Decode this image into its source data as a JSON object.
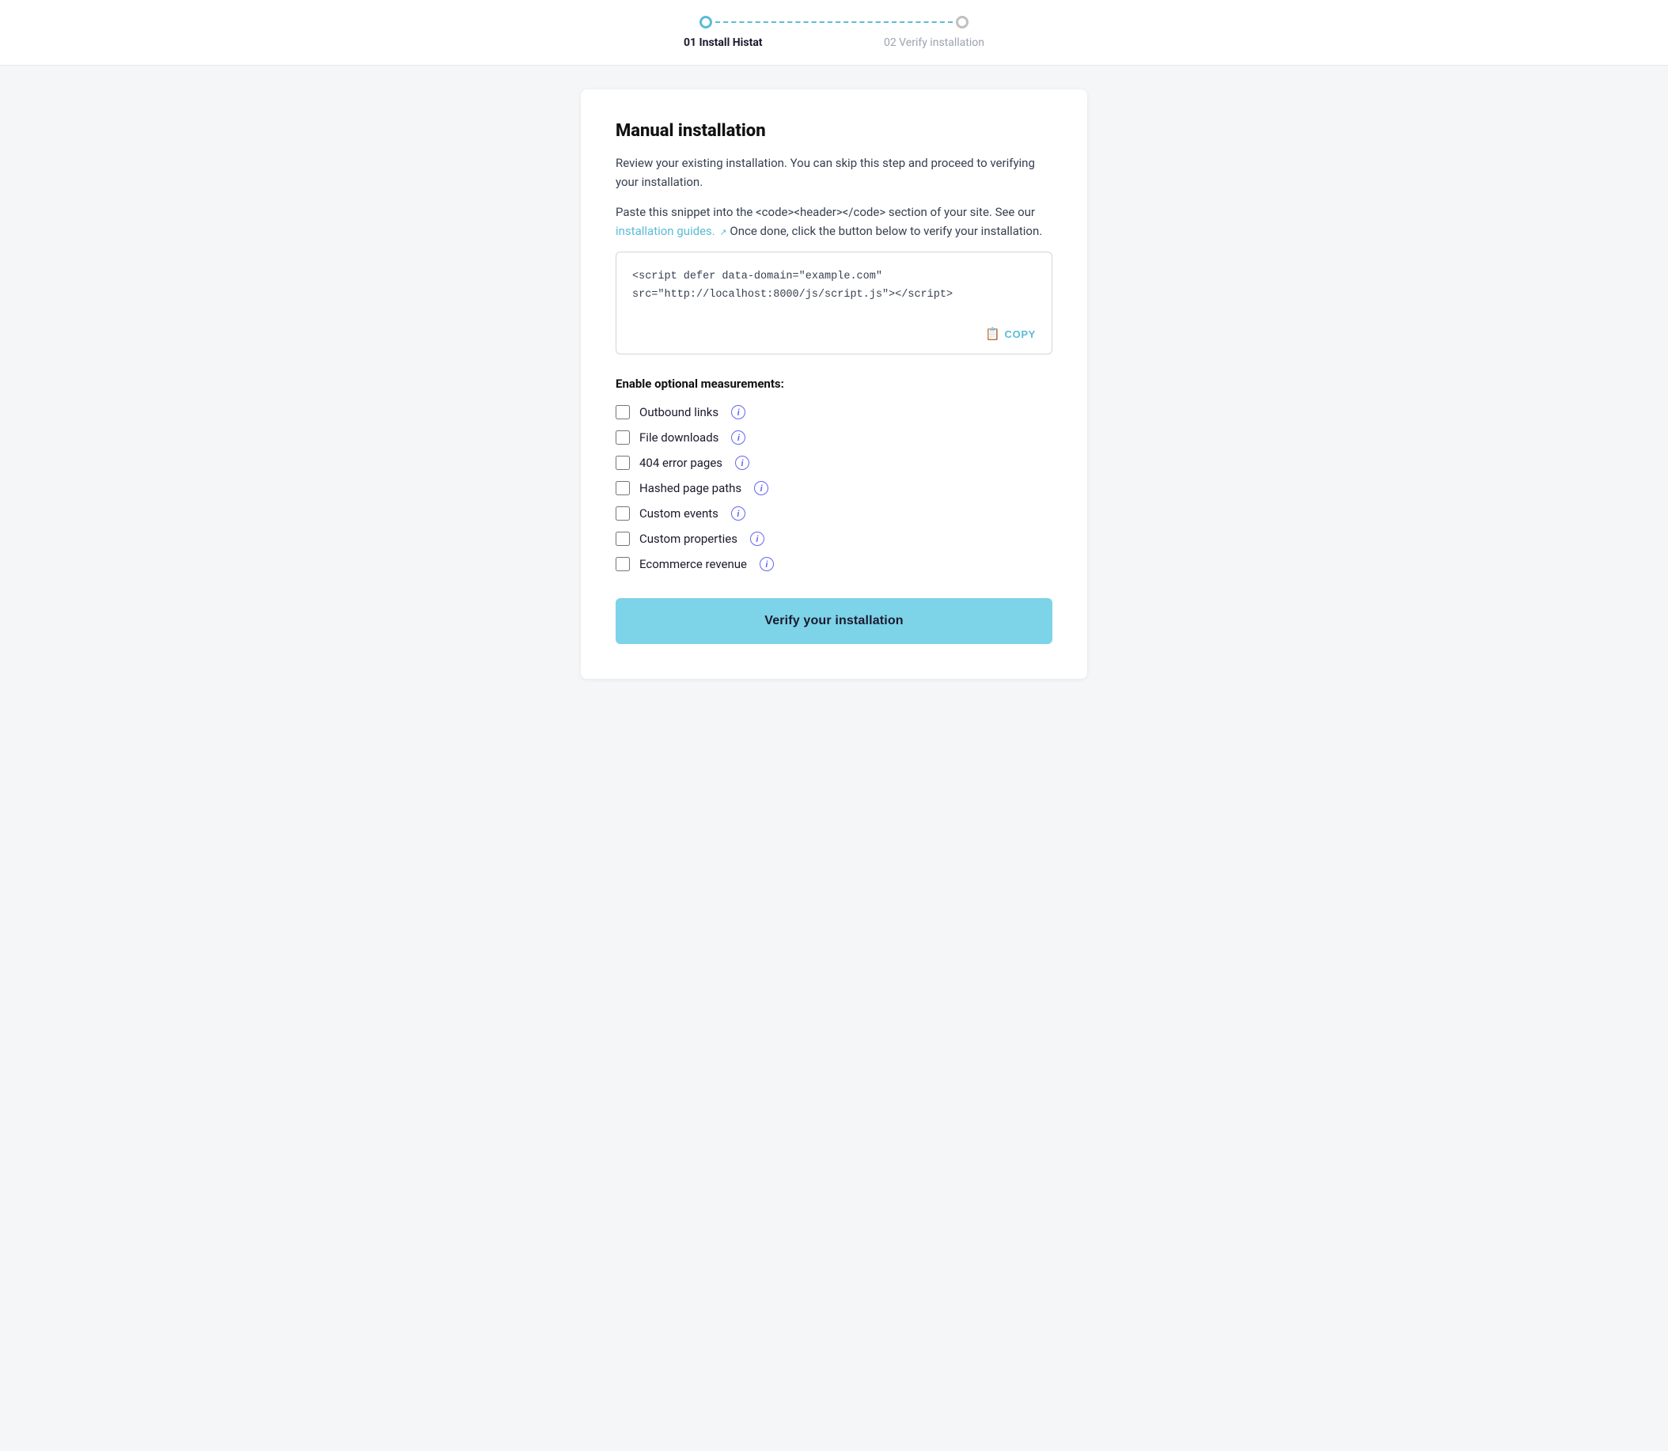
{
  "stepper": {
    "step1_label": "01 Install Histat",
    "step2_label": "02 Verify installation"
  },
  "card": {
    "title": "Manual installation",
    "description1": "Review your existing installation. You can skip this step and proceed to verifying your installation.",
    "description2_before": "Paste this snippet into the <code><header></code> section of your site. See our ",
    "description2_link": "installation guides.",
    "description2_after": " Once done, click the button below to verify your installation.",
    "code_snippet": "<script defer data-domain=\"example.com\"\nsrc=\"http://localhost:8000/js/script.js\"></script>",
    "copy_label": "COPY",
    "measurements_title": "Enable optional measurements:",
    "checkboxes": [
      {
        "id": "outbound",
        "label": "Outbound links"
      },
      {
        "id": "filedownloads",
        "label": "File downloads"
      },
      {
        "id": "404pages",
        "label": "404 error pages"
      },
      {
        "id": "hashed",
        "label": "Hashed page paths"
      },
      {
        "id": "customevents",
        "label": "Custom events"
      },
      {
        "id": "customprops",
        "label": "Custom properties"
      },
      {
        "id": "ecommerce",
        "label": "Ecommerce revenue"
      }
    ],
    "verify_btn_label": "Verify your installation"
  },
  "colors": {
    "accent": "#5bbcd6",
    "accent_light": "#7dd3e8",
    "info_icon": "#6366f1"
  },
  "icons": {
    "copy": "⎘",
    "external": "↗",
    "info": "i"
  }
}
